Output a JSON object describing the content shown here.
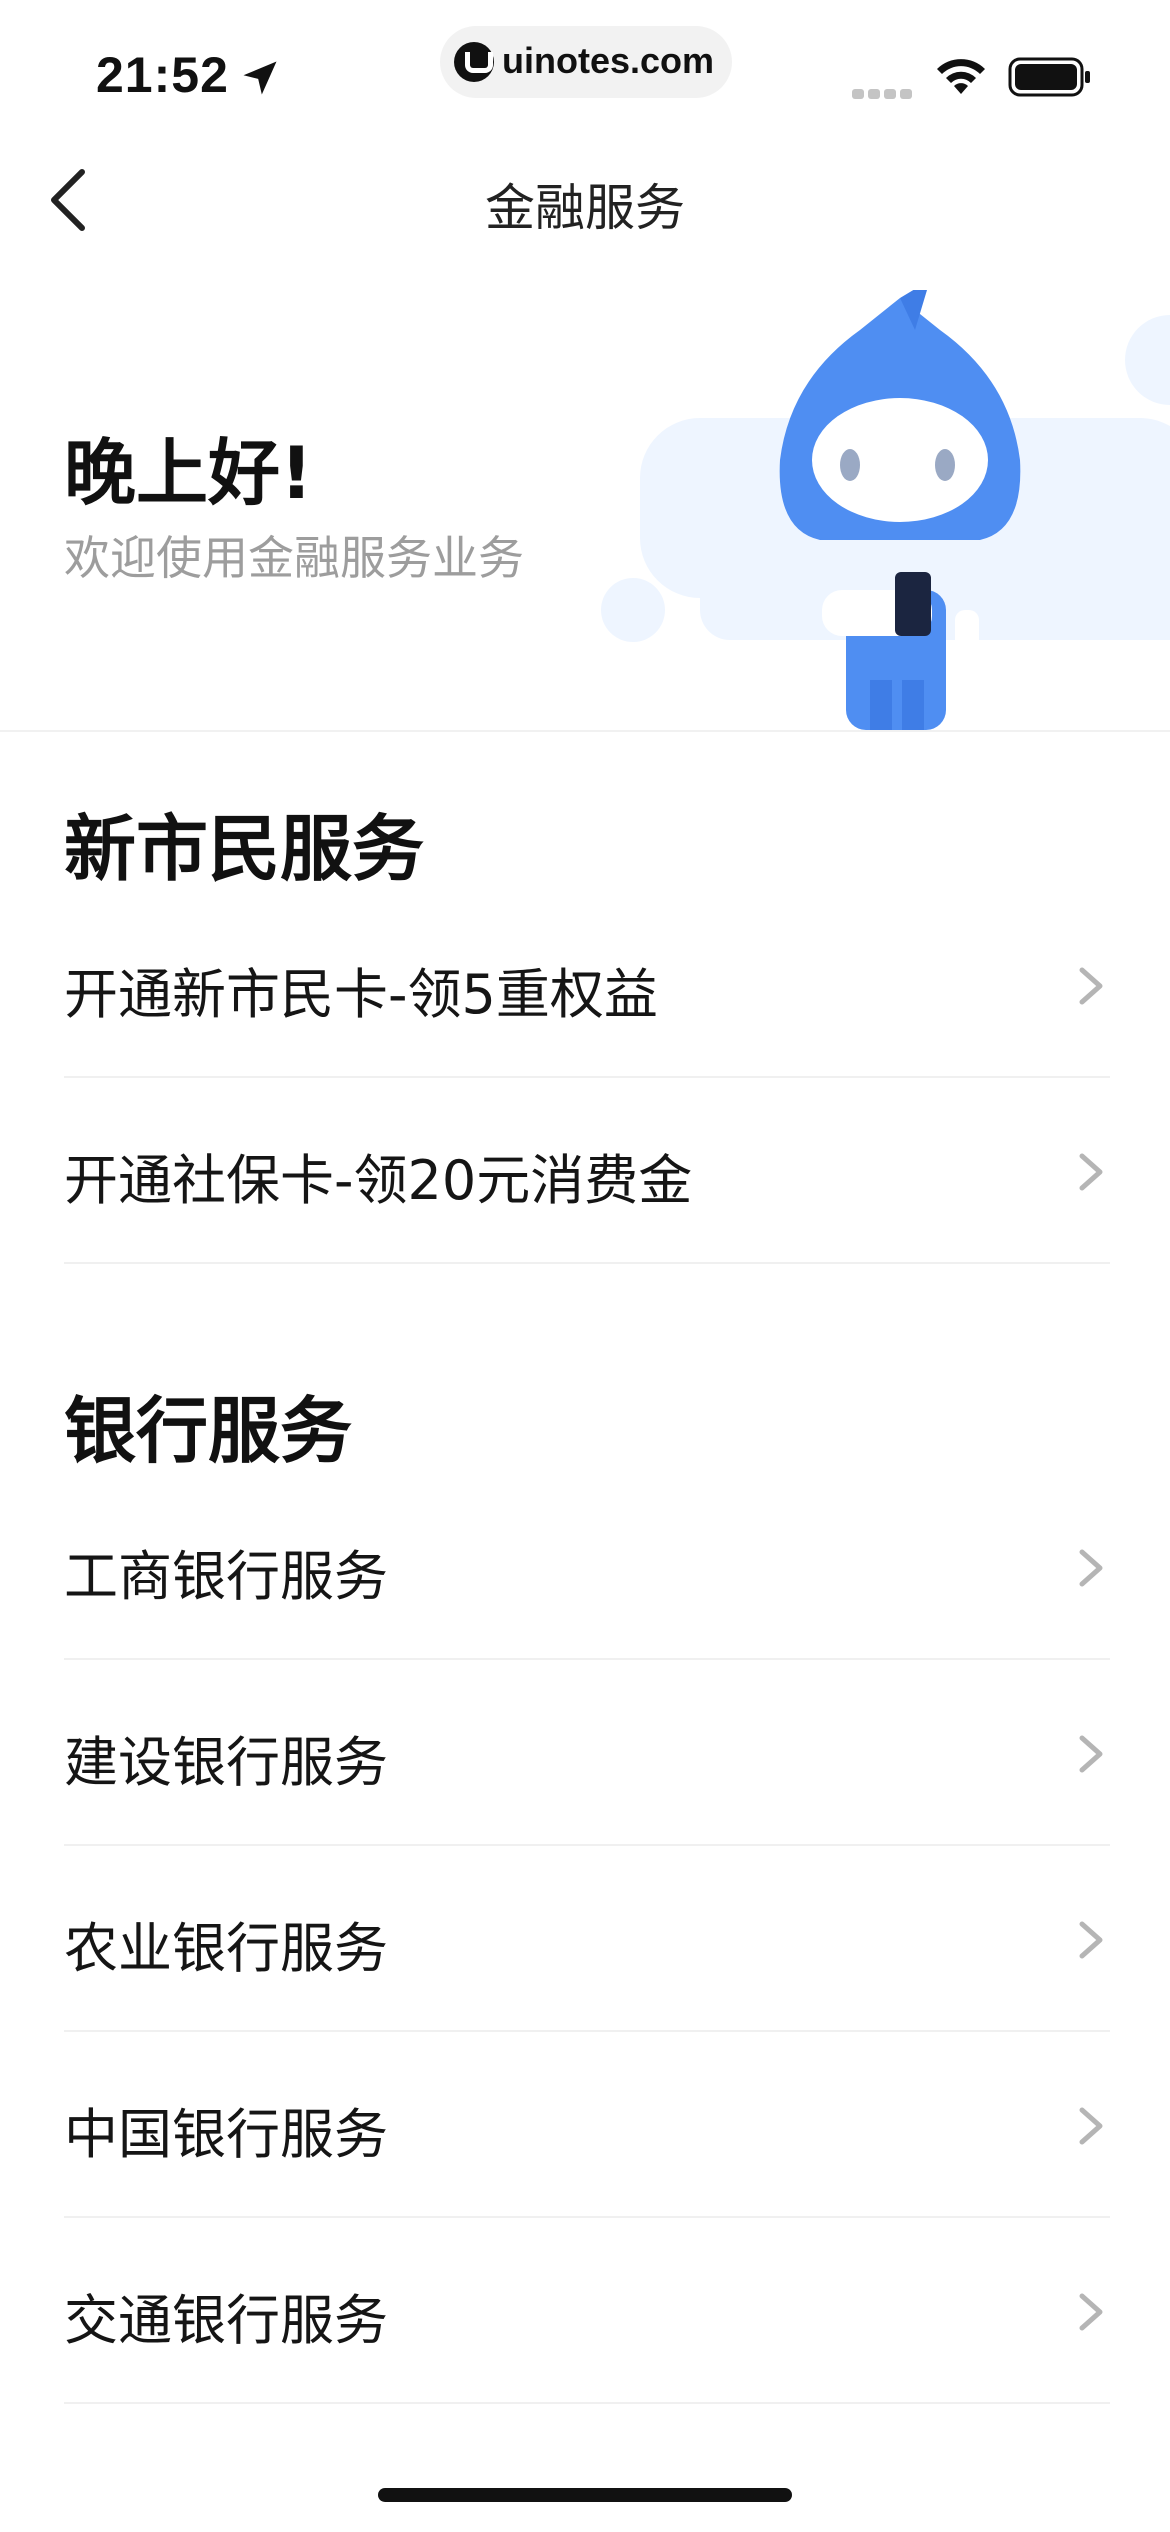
{
  "status_bar": {
    "time": "21:52",
    "url": "uinotes.com",
    "icons": [
      "location-arrow-icon",
      "signal-icon",
      "wifi-icon",
      "battery-icon"
    ]
  },
  "nav": {
    "title": "金融服务",
    "back_icon": "chevron-left-icon"
  },
  "hero": {
    "greeting": "晚上好!",
    "subtitle": "欢迎使用金融服务业务",
    "mascot": "blue-mascot-holding-card",
    "colors": {
      "mascot": "#4f8ef2",
      "cloud": "#eef5ff"
    }
  },
  "sections": [
    {
      "title": "新市民服务",
      "items": [
        {
          "label": "开通新市民卡-领5重权益"
        },
        {
          "label": "开通社保卡-领20元消费金"
        }
      ]
    },
    {
      "title": "银行服务",
      "items": [
        {
          "label": "工商银行服务"
        },
        {
          "label": "建设银行服务"
        },
        {
          "label": "农业银行服务"
        },
        {
          "label": "中国银行服务"
        },
        {
          "label": "交通银行服务"
        }
      ]
    }
  ]
}
